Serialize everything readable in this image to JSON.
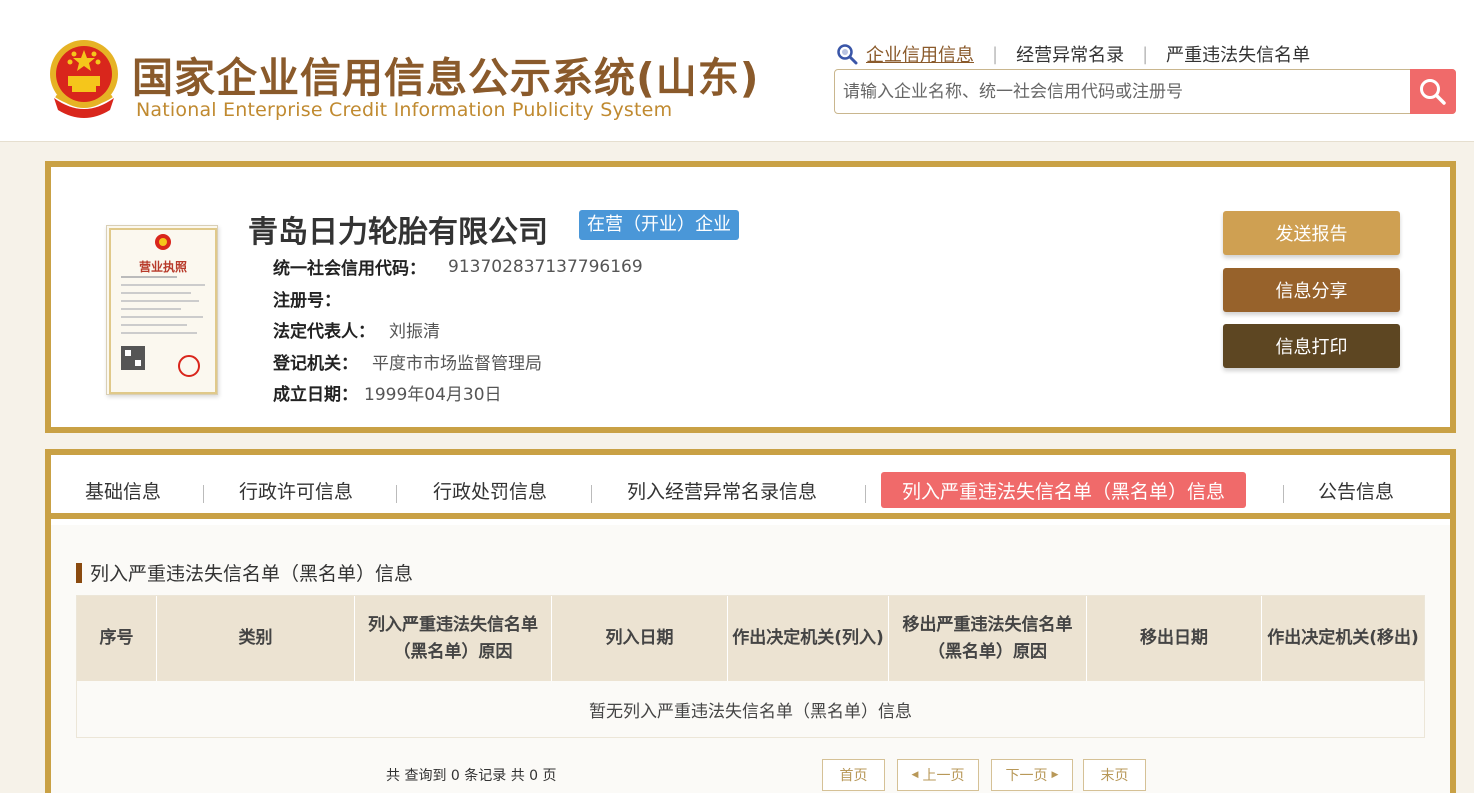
{
  "header": {
    "logo_cn": "国家企业信用信息公示系统(山东)",
    "logo_en": "National Enterprise Credit Information Publicity System",
    "top_links": [
      "企业信用信息",
      "经营异常名录",
      "严重违法失信名单"
    ],
    "search_placeholder": "请输入企业名称、统一社会信用代码或注册号"
  },
  "company": {
    "name": "青岛日力轮胎有限公司",
    "status": "在营（开业）企业",
    "license_title": "营业执照",
    "fields": [
      {
        "label": "统一社会信用代码：",
        "value": "913702837137796169"
      },
      {
        "label": "注册号：",
        "value": ""
      },
      {
        "label": "法定代表人：",
        "value": "刘振清"
      },
      {
        "label": "登记机关：",
        "value": "平度市市场监督管理局"
      },
      {
        "label": "成立日期：",
        "value": "1999年04月30日"
      }
    ],
    "actions": [
      "发送报告",
      "信息分享",
      "信息打印"
    ]
  },
  "tabs": [
    "基础信息",
    "行政许可信息",
    "行政处罚信息",
    "列入经营异常名录信息",
    "列入严重违法失信名单（黑名单）信息",
    "公告信息"
  ],
  "section": {
    "title": "列入严重违法失信名单（黑名单）信息",
    "columns": [
      "序号",
      "类别",
      "列入严重违法失信名单（黑名单）原因",
      "列入日期",
      "作出决定机关(列入)",
      "移出严重违法失信名单（黑名单）原因",
      "移出日期",
      "作出决定机关(移出)"
    ],
    "empty_text": "暂无列入严重违法失信名单（黑名单）信息"
  },
  "pager": {
    "summary": "共 查询到 0 条记录 共 0 页",
    "first": "首页",
    "prev": "上一页",
    "next": "下一页",
    "last": "末页"
  },
  "colors": {
    "gold_border": "#c9a145",
    "brown_title": "#8a5a2b",
    "active_tab": "#f06a6a",
    "status_blue": "#4a97d8",
    "btn_report": "#cfa052",
    "btn_share": "#97622b",
    "btn_print": "#5d4622"
  }
}
